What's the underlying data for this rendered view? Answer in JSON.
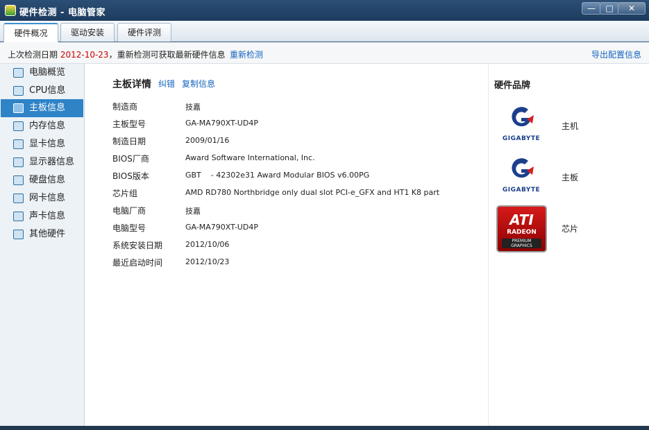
{
  "window": {
    "title": "硬件检测 - 电脑管家",
    "min_symbol": "—",
    "max_symbol": "□",
    "close_symbol": "✕"
  },
  "tabs": [
    {
      "label": "硬件概况",
      "active": true
    },
    {
      "label": "驱动安装",
      "active": false
    },
    {
      "label": "硬件评测",
      "active": false
    }
  ],
  "infobar": {
    "prefix": "上次检测日期 ",
    "date": "2012-10-23",
    "suffix": "，重新检测可获取最新硬件信息",
    "recheck_link": "重新检测",
    "export_link": "导出配置信息"
  },
  "sidebar": {
    "items": [
      {
        "label": "电脑概览",
        "icon": "clipboard-icon"
      },
      {
        "label": "CPU信息",
        "icon": "cpu-icon"
      },
      {
        "label": "主板信息",
        "icon": "motherboard-icon",
        "active": true
      },
      {
        "label": "内存信息",
        "icon": "memory-icon"
      },
      {
        "label": "显卡信息",
        "icon": "graphics-card-icon"
      },
      {
        "label": "显示器信息",
        "icon": "monitor-icon"
      },
      {
        "label": "硬盘信息",
        "icon": "harddisk-icon"
      },
      {
        "label": "网卡信息",
        "icon": "network-card-icon"
      },
      {
        "label": "声卡信息",
        "icon": "sound-card-icon"
      },
      {
        "label": "其他硬件",
        "icon": "other-hardware-icon"
      }
    ]
  },
  "details": {
    "title": "主板详情",
    "link_correct": "纠错",
    "link_copy": "复制信息",
    "rows": [
      {
        "key": "制造商",
        "value": "技嘉"
      },
      {
        "key": "主板型号",
        "value": "GA-MA790XT-UD4P"
      },
      {
        "key": "制造日期",
        "value": "2009/01/16"
      },
      {
        "key": "BIOS厂商",
        "value": "Award Software International, Inc."
      },
      {
        "key": "BIOS版本",
        "value": "GBT    - 42302e31 Award Modular BIOS v6.00PG"
      },
      {
        "key": "芯片组",
        "value": "AMD RD780 Northbridge only dual slot PCI-e_GFX and HT1 K8 part"
      },
      {
        "key": "电脑厂商",
        "value": "技嘉"
      },
      {
        "key": "电脑型号",
        "value": "GA-MA790XT-UD4P"
      },
      {
        "key": "系统安装日期",
        "value": "2012/10/06"
      },
      {
        "key": "最近启动时间",
        "value": "2012/10/23"
      }
    ]
  },
  "brands": {
    "title": "硬件品牌",
    "items": [
      {
        "logo_text": "GIGABYTE",
        "label": "主机"
      },
      {
        "logo_text": "GIGABYTE",
        "label": "主板"
      },
      {
        "logo_text_1": "ATI",
        "logo_text_2": "RADEON",
        "logo_text_3": "PREMIUM GRAPHICS",
        "label": "芯片"
      }
    ]
  },
  "colors": {
    "accent": "#2f83c7",
    "link": "#1565c0",
    "date_red": "#cc0000"
  }
}
